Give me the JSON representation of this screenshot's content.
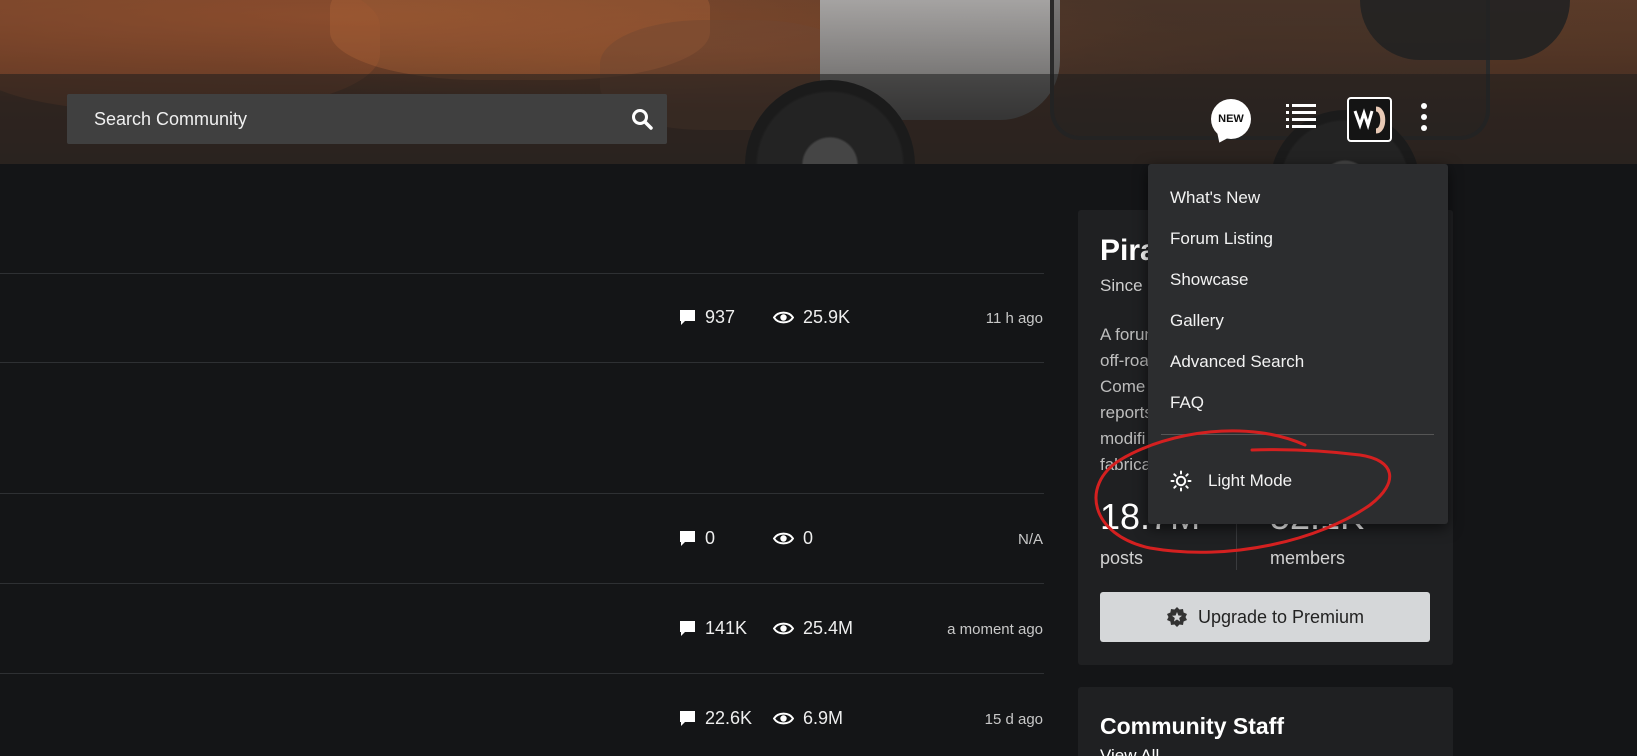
{
  "header": {
    "search": {
      "placeholder": "Search Community"
    },
    "new_badge": "NEW",
    "icons": [
      "search-icon",
      "new-posts-icon",
      "list-icon",
      "avatar",
      "kebab-menu-icon"
    ]
  },
  "topics": [
    {
      "replies": "937",
      "views": "25.9K",
      "last_activity": "11 h ago"
    },
    {
      "replies": "0",
      "views": "0",
      "last_activity": "N/A"
    },
    {
      "replies": "141K",
      "views": "25.4M",
      "last_activity": "a moment ago"
    },
    {
      "replies": "22.6K",
      "views": "6.9M",
      "last_activity": "15 d ago"
    }
  ],
  "sidebar": {
    "title": "Pira",
    "since": "Since",
    "description": "A forum\noff-roa\nCome\nreports\nmodifi\nfabrica",
    "posts_value": "18.7M",
    "posts_label": "posts",
    "members_value": "52.1K",
    "members_label": "members",
    "premium_button": "Upgrade to Premium"
  },
  "staff": {
    "title": "Community Staff",
    "view_all": "View All"
  },
  "dropdown": {
    "items": [
      "What's New",
      "Forum Listing",
      "Showcase",
      "Gallery",
      "Advanced Search",
      "FAQ"
    ],
    "light_mode": "Light Mode"
  },
  "colors": {
    "background": "#141517",
    "card": "#1f2022",
    "dropdown": "#2c2d2f",
    "annotation_red": "#d42020",
    "premium_button": "#d5d7d9"
  }
}
